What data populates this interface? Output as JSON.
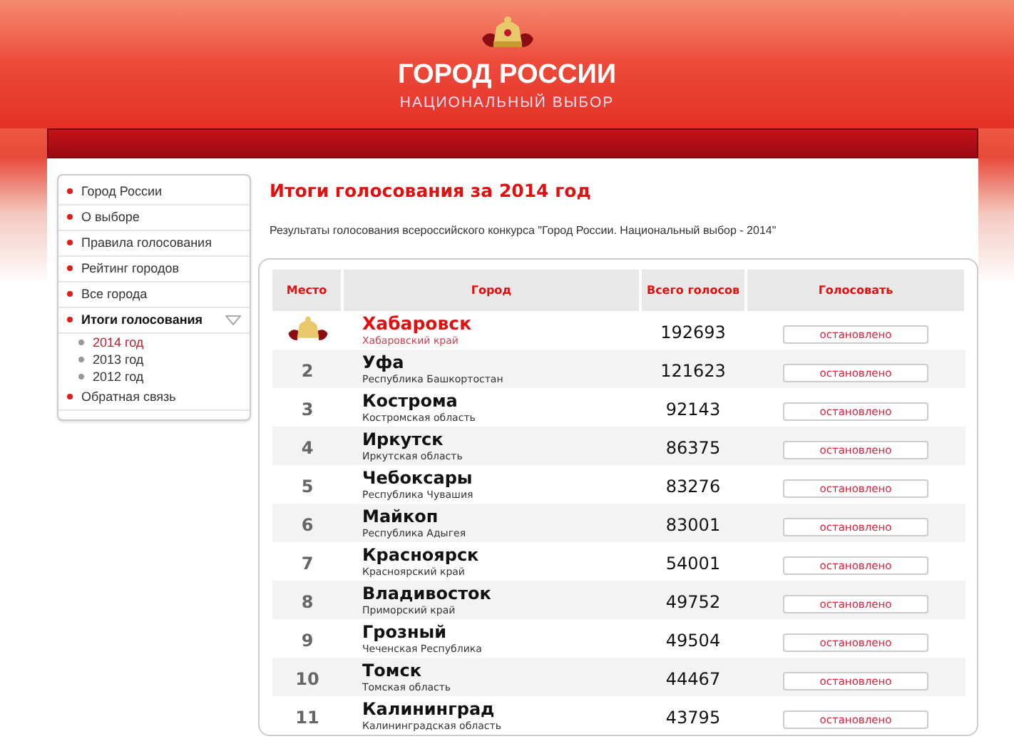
{
  "header": {
    "title": "ГОРОД РОССИИ",
    "subtitle": "НАЦИОНАЛЬНЫЙ ВЫБОР"
  },
  "sidebar": {
    "items": [
      {
        "label": "Город России",
        "selected": false
      },
      {
        "label": "О выборе",
        "selected": false
      },
      {
        "label": "Правила голосования",
        "selected": false
      },
      {
        "label": "Рейтинг городов",
        "selected": false
      },
      {
        "label": "Все города",
        "selected": false
      },
      {
        "label": "Итоги голосования",
        "selected": true,
        "expanded": true,
        "children": [
          {
            "label": "2014 год",
            "selected": true
          },
          {
            "label": "2013 год",
            "selected": false
          },
          {
            "label": "2012 год",
            "selected": false
          }
        ]
      },
      {
        "label": "Обратная связь",
        "selected": false
      }
    ]
  },
  "main": {
    "title": "Итоги голосования за 2014 год",
    "intro": "Результаты голосования всероссийского конкурса \"Город России. Национальный выбор - 2014\""
  },
  "table": {
    "columns": [
      "Место",
      "Город",
      "Всего голосов",
      "Голосовать"
    ],
    "rows": [
      {
        "kind": "crown",
        "city": "Хабаровск",
        "region": "Хабаровский край",
        "votes": "192693",
        "action": "остановлено"
      },
      {
        "kind": "number",
        "place": "2",
        "city": "Уфа",
        "region": "Республика Башкортостан",
        "votes": "121623",
        "action": "остановлено"
      },
      {
        "kind": "number",
        "place": "3",
        "city": "Кострома",
        "region": "Костромская область",
        "votes": "92143",
        "action": "остановлено"
      },
      {
        "kind": "number",
        "place": "4",
        "city": "Иркутск",
        "region": "Иркутская область",
        "votes": "86375",
        "action": "остановлено"
      },
      {
        "kind": "number",
        "place": "5",
        "city": "Чебоксары",
        "region": "Республика Чувашия",
        "votes": "83276",
        "action": "остановлено"
      },
      {
        "kind": "number",
        "place": "6",
        "city": "Майкоп",
        "region": "Республика Адыгея",
        "votes": "83001",
        "action": "остановлено"
      },
      {
        "kind": "number",
        "place": "7",
        "city": "Красноярск",
        "region": "Красноярский край",
        "votes": "54001",
        "action": "остановлено"
      },
      {
        "kind": "number",
        "place": "8",
        "city": "Владивосток",
        "region": "Приморский край",
        "votes": "49752",
        "action": "остановлено"
      },
      {
        "kind": "number",
        "place": "9",
        "city": "Грозный",
        "region": "Чеченская Республика",
        "votes": "49504",
        "action": "остановлено"
      },
      {
        "kind": "number",
        "place": "10",
        "city": "Томск",
        "region": "Томская область",
        "votes": "44467",
        "action": "остановлено"
      },
      {
        "kind": "number",
        "place": "11",
        "city": "Калининград",
        "region": "Калининградская область",
        "votes": "43795",
        "action": "остановлено"
      }
    ]
  }
}
